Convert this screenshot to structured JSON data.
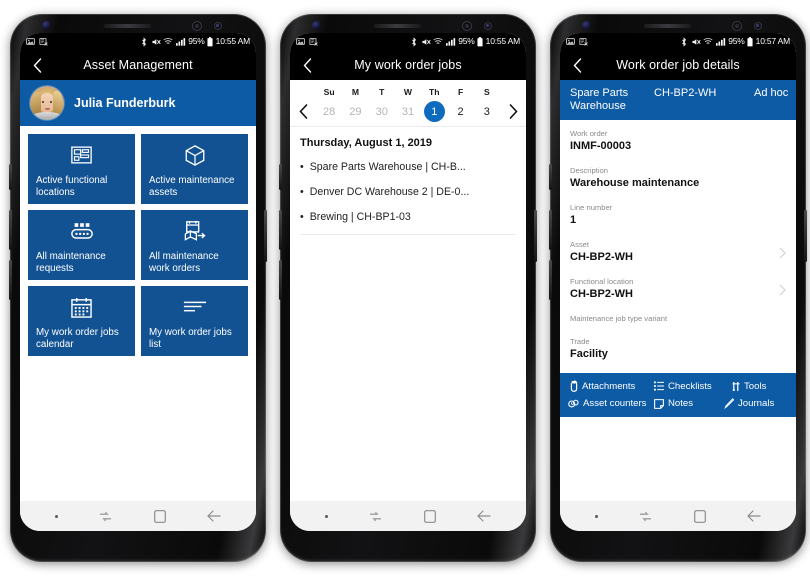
{
  "status_bar": {
    "icons_left": [
      "image-icon",
      "screenshot-icon"
    ],
    "icons_right": [
      "bluetooth-icon",
      "mute-icon",
      "wifi-icon",
      "signal-icon"
    ],
    "battery_percent": "95%",
    "time_phone1": "10:55 AM",
    "time_phone2": "10:55 AM",
    "time_phone3": "10:57 AM"
  },
  "navbar": {
    "dot": "",
    "recents_label": "recents-icon",
    "home_label": "home-icon",
    "back_label": "back-icon"
  },
  "phone1": {
    "appbar": {
      "title": "Asset Management",
      "back": "‹"
    },
    "profile": {
      "name": "Julia Funderburk"
    },
    "tiles": [
      {
        "icon": "floorplan-icon",
        "label": "Active functional locations"
      },
      {
        "icon": "box-icon",
        "label": "Active maintenance assets"
      },
      {
        "icon": "conveyor-icon",
        "label": "All maintenance requests"
      },
      {
        "icon": "workorder-icon",
        "label": "All maintenance work orders"
      },
      {
        "icon": "calendar-icon",
        "label": "My work order jobs calendar"
      },
      {
        "icon": "list-icon",
        "label": "My work order jobs list"
      }
    ]
  },
  "phone2": {
    "appbar": {
      "title": "My work order jobs",
      "back": "‹"
    },
    "calendar": {
      "day_headers": [
        "Su",
        "M",
        "T",
        "W",
        "Th",
        "F",
        "S"
      ],
      "days": [
        "28",
        "29",
        "30",
        "31",
        "1",
        "2",
        "3"
      ],
      "dimmed": [
        true,
        true,
        true,
        true,
        false,
        false,
        false
      ],
      "selected_index": 4,
      "prev_label": "‹",
      "next_label": "›"
    },
    "date_header": "Thursday, August 1, 2019",
    "jobs": [
      "Spare Parts Warehouse | CH-B...",
      "Denver DC Warehouse 2 | DE-0...",
      "Brewing | CH-BP1-03"
    ]
  },
  "phone3": {
    "appbar": {
      "title": "Work order job details",
      "back": "‹"
    },
    "pivots": [
      "Spare Parts Warehouse",
      "CH-BP2-WH",
      "Ad hoc"
    ],
    "fields": [
      {
        "label": "Work order",
        "value": "INMF-00003",
        "chevron": false
      },
      {
        "label": "Description",
        "value": "Warehouse maintenance",
        "chevron": false
      },
      {
        "label": "Line number",
        "value": "1",
        "chevron": false
      },
      {
        "label": "Asset",
        "value": "CH-BP2-WH",
        "chevron": true
      },
      {
        "label": "Functional location",
        "value": "CH-BP2-WH",
        "chevron": true
      },
      {
        "label": "Maintenance job type variant",
        "value": "",
        "chevron": false
      },
      {
        "label": "Trade",
        "value": "Facility",
        "chevron": false
      }
    ],
    "actions_row1": [
      {
        "icon": "attachment-icon",
        "label": "Attachments"
      },
      {
        "icon": "checklist-icon",
        "label": "Checklists"
      },
      {
        "icon": "tools-icon",
        "label": "Tools"
      }
    ],
    "actions_row2": [
      {
        "icon": "counter-icon",
        "label": "Asset counters"
      },
      {
        "icon": "note-icon",
        "label": "Notes"
      },
      {
        "icon": "journal-icon",
        "label": "Journals"
      }
    ]
  },
  "colors": {
    "brand_blue": "#0d5ba5",
    "tile_blue": "#125293",
    "selected_day": "#0f6cbd",
    "appbar_black": "#000000"
  }
}
